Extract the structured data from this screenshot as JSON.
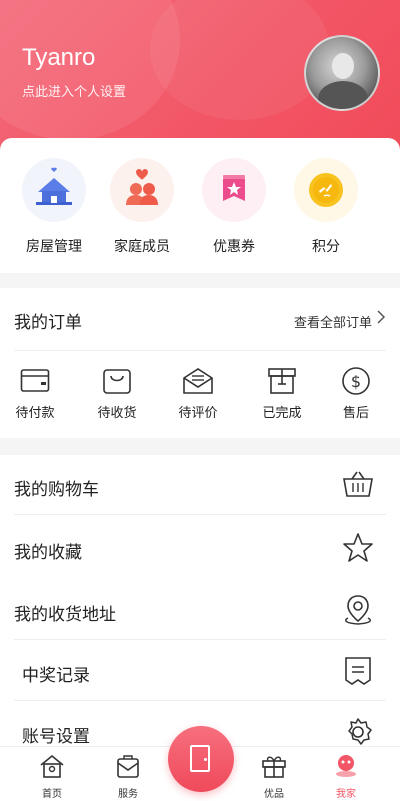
{
  "header": {
    "username": "Tyanro",
    "subtitle": "点此进入个人设置"
  },
  "quick": [
    {
      "label": "房屋管理",
      "icon": "house-icon"
    },
    {
      "label": "家庭成员",
      "icon": "family-members-icon"
    },
    {
      "label": "优惠券",
      "icon": "coupon-icon"
    },
    {
      "label": "积分",
      "icon": "points-icon"
    }
  ],
  "orders": {
    "title": "我的订单",
    "view_all": "查看全部订单",
    "items": [
      {
        "label": "待付款",
        "icon": "wallet-icon"
      },
      {
        "label": "待收货",
        "icon": "bag-icon"
      },
      {
        "label": "待评价",
        "icon": "envelope-icon"
      },
      {
        "label": "已完成",
        "icon": "box-icon"
      },
      {
        "label": "售后",
        "icon": "dollar-icon"
      }
    ]
  },
  "menu": [
    {
      "label": "我的购物车",
      "icon": "basket-icon"
    },
    {
      "label": "我的收藏",
      "icon": "star-icon"
    },
    {
      "label": "我的收货地址",
      "icon": "location-icon"
    },
    {
      "label": "中奖记录",
      "icon": "receipt-icon"
    },
    {
      "label": "账号设置",
      "icon": "gear-icon"
    }
  ],
  "tabs": [
    {
      "label": "首页",
      "icon": "home-icon"
    },
    {
      "label": "服务",
      "icon": "service-icon"
    },
    {
      "label": "优品",
      "icon": "gift-icon"
    },
    {
      "label": "我家",
      "icon": "my-home-icon"
    }
  ],
  "colors": {
    "accent": "#f25565",
    "header_gradient_start": "#f36a7a",
    "header_gradient_end": "#f14a58"
  }
}
